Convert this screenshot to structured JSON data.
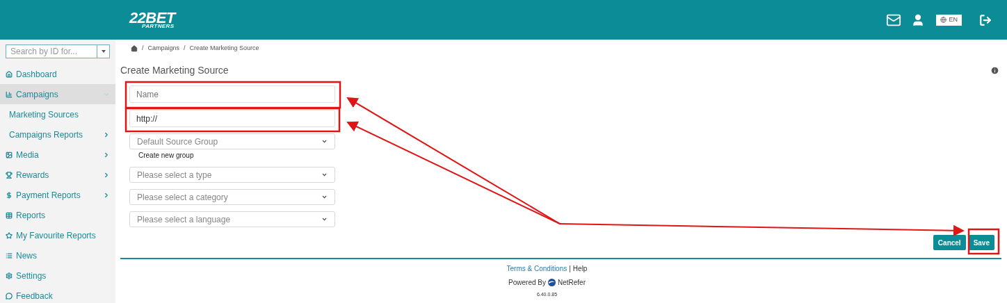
{
  "header": {
    "logo": {
      "main": "22BET",
      "sub": "PARTNERS"
    },
    "language": "EN"
  },
  "sidebar": {
    "search": {
      "placeholder": "Search by ID for..."
    },
    "items": [
      {
        "label": "Dashboard",
        "selected": false,
        "expandable": false
      },
      {
        "label": "Campaigns",
        "selected": true,
        "expandable": true,
        "expanded": true,
        "children": [
          {
            "label": "Marketing Sources",
            "selected": false,
            "expandable": false
          },
          {
            "label": "Campaigns Reports",
            "selected": false,
            "expandable": true,
            "expanded": false
          }
        ]
      },
      {
        "label": "Media",
        "selected": false,
        "expandable": true,
        "expanded": false
      },
      {
        "label": "Rewards",
        "selected": false,
        "expandable": true,
        "expanded": false
      },
      {
        "label": "Payment Reports",
        "selected": false,
        "expandable": true,
        "expanded": false
      },
      {
        "label": "Reports",
        "selected": false,
        "expandable": false
      },
      {
        "label": "My Favourite Reports",
        "selected": false,
        "expandable": false
      },
      {
        "label": "News",
        "selected": false,
        "expandable": false
      },
      {
        "label": "Settings",
        "selected": false,
        "expandable": false
      },
      {
        "label": "Feedback",
        "selected": false,
        "expandable": false
      }
    ]
  },
  "breadcrumb": [
    {
      "separator": "/",
      "label": "Campaigns"
    },
    {
      "separator": "/",
      "label": "Create Marketing Source"
    }
  ],
  "title": "Create Marketing Source",
  "form": {
    "fields": [
      {
        "kind": "input",
        "placeholder": "Name"
      },
      {
        "kind": "input",
        "value": "http://"
      },
      {
        "kind": "select",
        "placeholder": "Default Source Group",
        "link": "Create new group"
      },
      {
        "kind": "select",
        "placeholder": "Please select a type"
      },
      {
        "kind": "select",
        "placeholder": "Please select a category"
      },
      {
        "kind": "select",
        "placeholder": "Please select a language"
      }
    ],
    "buttons": [
      "Cancel",
      "Save"
    ]
  },
  "footer": {
    "terms": "Terms & Conditions",
    "separator": "|",
    "help": "Help",
    "powered_by": "Powered By",
    "brand": "NetRefer",
    "version": "6.40.0.85"
  }
}
